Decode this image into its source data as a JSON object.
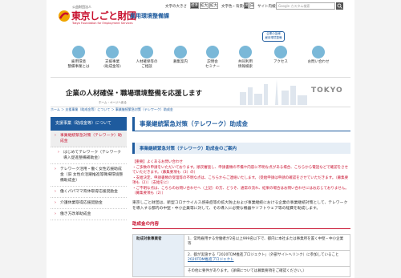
{
  "header": {
    "org_small": "公益財団法人",
    "org_name": "東京しごと財団",
    "org_en": "Tokyo Foundation for Employment Services",
    "department": "雇用環境整備課",
    "font_size_label": "文字の大きさ",
    "font_sizes": [
      "標準",
      "拡大",
      "拡大"
    ],
    "color_label": "文字色・背景色",
    "color_options": [
      "黒",
      "白"
    ],
    "site_search_label": "サイト内検索",
    "search_placeholder": "Google カスタム検索",
    "badge_line1": "企業の皆様",
    "badge_line2": "雇用環境整備"
  },
  "nav": [
    {
      "label1": "雇用環境",
      "label2": "整備事業とは"
    },
    {
      "label1": "支援事業",
      "label2": "(助成金等)"
    },
    {
      "label1": "人材確保等の",
      "label2": "ご相談"
    },
    {
      "label1": "募集案内",
      "label2": ""
    },
    {
      "label1": "説明会",
      "label2": "セミナー"
    },
    {
      "label1": "共同利用",
      "label2": "情報検索"
    },
    {
      "label1": "アクセス",
      "label2": ""
    },
    {
      "label1": "お問い合わせ",
      "label2": ""
    }
  ],
  "banner": {
    "title": "企業の人材確保・職場環境整備を応援します",
    "sub": "ホーム・ページへ戻る",
    "tokyo": "TOKYO"
  },
  "breadcrumb": "ホーム ＞ 支援事業（助成金等）について ＞ 事業継続緊急対策（テレワーク）助成金",
  "sidebar": {
    "head": "支援事業（助成金等）について",
    "items": [
      {
        "label": "事業継続緊急対策（テレワーク）助成金",
        "active": true,
        "sub": false
      },
      {
        "label": "はじめてテレワーク（テレワーク導入促進整備補助金）",
        "active": false,
        "sub": true
      },
      {
        "label": "テレワーク活用・働く女性応援助成金（旧 女性の活躍推進等職場環境整備助成金）",
        "active": false,
        "sub": false
      },
      {
        "label": "働くパパママ育休取得応援奨励金",
        "active": false,
        "sub": false
      },
      {
        "label": "介護休業取得応援奨励金",
        "active": false,
        "sub": false
      },
      {
        "label": "働き方改革助成金",
        "active": false,
        "sub": false
      }
    ]
  },
  "main": {
    "title": "事業継続緊急対策（テレワーク）助成金",
    "section": "事業継続緊急対策（テレワーク）助成金のご案内",
    "notice": "【重要】よくあるお問い合わせ\n・ご多数の申請をいただいております。順次審査し、申請書類の不備や内容に不明な点がある場合、こちらから電話などで確認をさせていただきます。（募集要項も（3）の）\n・支給決定、申請書類の受理等の不明な点は、こちらからご連絡いたします。（受給申請は申請の確認をさせていただきます。（募集要項も（2））（支給をに）\n・ご不明な点は、こちらのお問い合わせへ（上記）の方、どうぞ、通常の流れ、結果の場合はお問い合わせにはお応じておりません。（募集要項も（2））",
    "para": "東京しごと財団は、新型コロナウイルス感染症等の拡大防止および事業継続における企業の事業継続対策として、テレワークを導入する都内の中堅・中小企業等に対して、その導入に必要な機器やソフトウェア等の経費を助成します。",
    "h3": "助成金の内容",
    "table_label": "助成対象事業者",
    "table_rows": [
      "1．常時雇用する労働者が2名以上999名以下で、都内に本社または事業所を置く中堅・中小企業等",
      "2．都が実施する「2020TDM推進プロジェクト」（外部サイトへリンク）に参加していること",
      "その他に要件があります。（詳細については募集要項をご確認ください。）"
    ],
    "link_text": "2020TDM推進プロジェクト"
  }
}
